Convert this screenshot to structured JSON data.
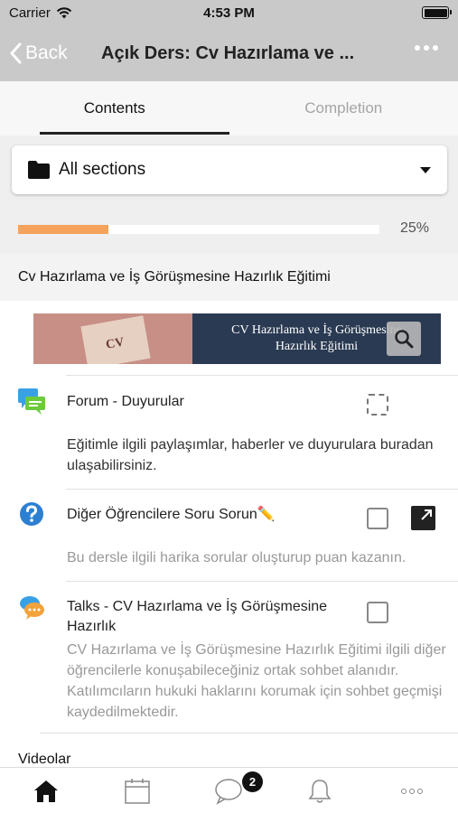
{
  "status_bar": {
    "carrier": "Carrier",
    "time": "4:53 PM"
  },
  "nav": {
    "back_label": "Back",
    "title": "Açık Ders: Cv Hazırlama ve ..."
  },
  "tabs": [
    {
      "label": "Contents",
      "active": true
    },
    {
      "label": "Completion",
      "active": false
    }
  ],
  "section_select": {
    "value": "All sections"
  },
  "progress": {
    "percent": 25,
    "label": "25%"
  },
  "course": {
    "title": "Cv Hazırlama ve İş Görüşmesine Hazırlık Eğitimi",
    "banner": {
      "cv_mark": "CV",
      "line1": "CV Hazırlama ve İş Görüşmesine",
      "line2": "Hazırlık Eğitimi"
    }
  },
  "activities": [
    {
      "name": "Forum - Duyurular",
      "description": "Eğitimle ilgili paylaşımlar, haberler ve duyurulara buradan ulaşabilirsiniz.",
      "icon": "forum-icon",
      "completion": "automatic-dashed"
    },
    {
      "name": "Diğer Öğrencilere Soru Sorun✏️",
      "description": "Bu dersle ilgili harika sorular oluşturup puan kazanın.",
      "icon": "question-icon",
      "completion": "manual"
    },
    {
      "name": "Talks - CV Hazırlama ve İş Görüşmesine Hazırlık",
      "description": "CV Hazırlama ve İş Görüşmesine Hazırlık Eğitimi ilgili diğer öğrencilerle konuşabileceğiniz ortak sohbet alanıdır. Katılımcıların hukuki haklarını korumak için sohbet geçmişi kaydedilmektedir.",
      "icon": "chat-icon",
      "completion": "manual"
    }
  ],
  "next_section": "Videolar",
  "tabbar": {
    "items": [
      "home-icon",
      "calendar-icon",
      "messages-icon",
      "bell-icon",
      "more-icon"
    ],
    "messages_badge": "2"
  },
  "colors": {
    "progress": "#f5a35a",
    "header": "#c9c9c9",
    "forum_icon": "#3aa0e6",
    "question_icon": "#2d7fd1"
  }
}
